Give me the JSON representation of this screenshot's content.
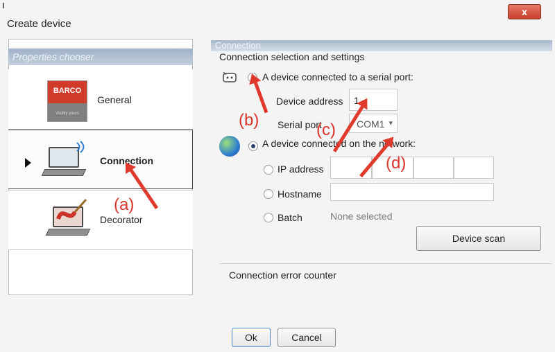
{
  "window": {
    "title": "Create device",
    "close_symbol": "x"
  },
  "chooser": {
    "header": "Properties chooser",
    "items": [
      {
        "label": "General",
        "icon": "barco-logo-icon",
        "logo_text": "BARCO",
        "logo_sub": "Visibly yours"
      },
      {
        "label": "Connection",
        "icon": "laptop-network-icon",
        "selected": true
      },
      {
        "label": "Decorator",
        "icon": "laptop-paint-icon"
      }
    ]
  },
  "connection": {
    "header": "Connection",
    "section_title": "Connection selection and settings",
    "serial": {
      "radio_label": "A device connected to a serial port:",
      "device_address_label": "Device address",
      "device_address_value": "1",
      "serial_port_label": "Serial port",
      "serial_port_value": "COM1"
    },
    "network": {
      "radio_label": "A device connected on the network:",
      "ip_label": "IP address",
      "hostname_label": "Hostname",
      "batch_label": "Batch",
      "batch_value": "None selected",
      "scan_button": "Device scan"
    },
    "error_counter_label": "Connection error counter"
  },
  "buttons": {
    "ok": "Ok",
    "cancel": "Cancel"
  },
  "annotations": {
    "a": "(a)",
    "b": "(b)",
    "c": "(c)",
    "d": "(d)"
  },
  "colors": {
    "annotation": "#d9352b",
    "header_blue": "#9fb0c7"
  }
}
